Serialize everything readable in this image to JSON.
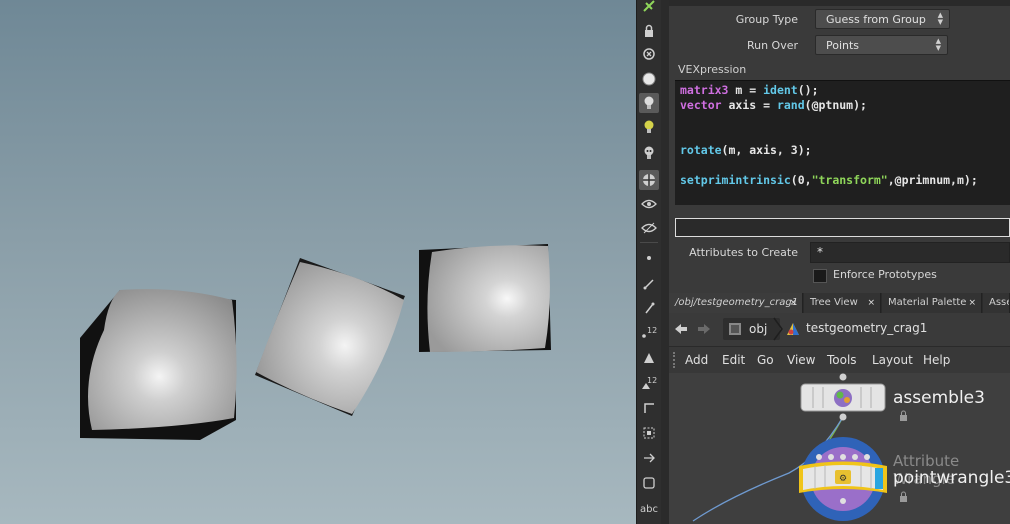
{
  "toolbar": {
    "bottom_label": "abc"
  },
  "params": {
    "group_type": {
      "label": "Group Type",
      "value": "Guess from Group"
    },
    "run_over": {
      "label": "Run Over",
      "value": "Points"
    },
    "vex_label": "VEXpression",
    "code": {
      "l1_kw": "matrix3",
      "l1_a": " m = ",
      "l1_fn": "ident",
      "l1_b": "();",
      "l2_kw": "vector",
      "l2_a": " axis = ",
      "l2_fn": "rand",
      "l2_b": "(@ptnum);",
      "l3_fn": "rotate",
      "l3_b": "(m, axis, 3);",
      "l4_fn": "setprimintrinsic",
      "l4_a": "(0,",
      "l4_str": "\"transform\"",
      "l4_b": ",@primnum,m);"
    },
    "attributes_to_create": {
      "label": "Attributes to Create",
      "value": "*"
    },
    "enforce_prototypes": {
      "label": "Enforce Prototypes"
    }
  },
  "tabs": [
    {
      "label": "/obj/testgeometry_crag1",
      "close": "×"
    },
    {
      "label": "Tree View",
      "close": "×"
    },
    {
      "label": "Material Palette",
      "close": "×"
    },
    {
      "label": "Asse"
    }
  ],
  "path": {
    "root": "obj",
    "node": "testgeometry_crag1"
  },
  "menu": [
    "Add",
    "Edit",
    "Go",
    "View",
    "Tools",
    "Layout",
    "Help"
  ],
  "nodes": {
    "assemble": "assemble3",
    "wrangle_type": "Attribute Wrangle",
    "wrangle_name": "pointwrangle3"
  },
  "colors": {
    "accent_yellow": "#f0c419",
    "wrangle_ring": "#2f63b8",
    "wrangle_inner": "#9a6fc9",
    "vex_keyword": "#cf6fe0",
    "vex_function": "#62c8e8",
    "vex_string": "#8fd65a"
  }
}
